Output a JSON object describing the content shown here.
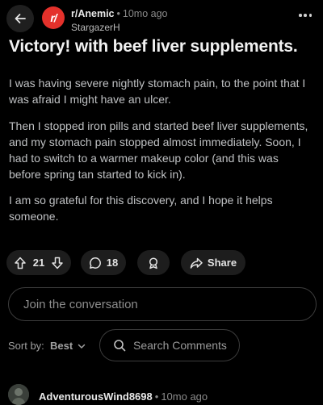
{
  "header": {
    "subreddit": "r/Anemic",
    "separator": "•",
    "age": "10mo ago",
    "author": "StargazerH",
    "icon_text": "r/"
  },
  "post": {
    "title": "Victory! with beef liver supplements.",
    "paragraphs": [
      "I was having severe nightly stomach pain, to the point that I was afraid I might have an ulcer.",
      "Then I stopped iron pills and started beef liver supplements, and my stomach pain stopped almost immediately. Soon, I had to switch to a warmer makeup color (and this was before spring tan started to kick in).",
      "I am so grateful for this discovery, and I hope it helps someone."
    ]
  },
  "actions": {
    "votes": "21",
    "comments": "18",
    "share_label": "Share"
  },
  "composer": {
    "placeholder": "Join the conversation"
  },
  "sort": {
    "label": "Sort by:",
    "value": "Best"
  },
  "search": {
    "placeholder": "Search Comments"
  },
  "comment": {
    "username": "AdventurousWind8698",
    "separator": "•",
    "age": "10mo ago"
  },
  "colors": {
    "background": "#000000",
    "pill_background": "#1d1d1d",
    "subreddit_icon": "#e4312b"
  }
}
